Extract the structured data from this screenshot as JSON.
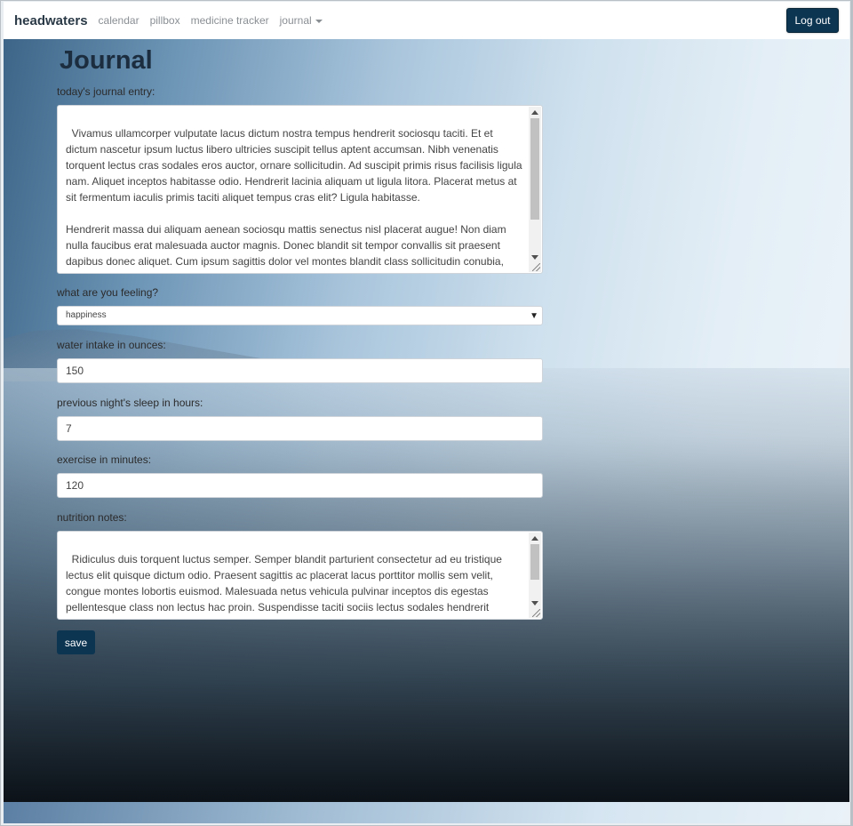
{
  "nav": {
    "brand": "headwaters",
    "links": [
      "calendar",
      "pillbox",
      "medicine tracker"
    ],
    "dropdown": "journal",
    "logout": "Log out"
  },
  "page": {
    "title": "Journal"
  },
  "form": {
    "entry_label": "today's journal entry:",
    "entry_value": "Vivamus ullamcorper vulputate lacus dictum nostra tempus hendrerit sociosqu taciti. Et et dictum nascetur ipsum luctus libero ultricies suscipit tellus aptent accumsan. Nibh venenatis torquent lectus cras sodales eros auctor, ornare sollicitudin. Ad suscipit primis risus facilisis ligula nam. Aliquet inceptos habitasse odio. Hendrerit lacinia aliquam ut ligula litora. Placerat metus at sit fermentum iaculis primis taciti aliquet tempus cras elit? Ligula habitasse.\n\nHendrerit massa dui aliquam aenean sociosqu mattis senectus nisl placerat augue! Non diam nulla faucibus erat malesuada auctor magnis. Donec blandit sit tempor convallis sit praesent dapibus donec aliquet. Cum ipsum sagittis dolor vel montes blandit class sollicitudin conubia, mauris erat. Quis curabitur fringilla leo aptent, fusce posuere in aenean quis etiam. Fermentum",
    "feeling_label": "what are you feeling?",
    "feeling_value": "happiness",
    "water_label": "water intake in ounces:",
    "water_value": "150",
    "sleep_label": "previous night's sleep in hours:",
    "sleep_value": "7",
    "exercise_label": "exercise in minutes:",
    "exercise_value": "120",
    "nutrition_label": "nutrition notes:",
    "nutrition_value": "Ridiculus duis torquent luctus semper. Semper blandit parturient consectetur ad eu tristique lectus elit quisque dictum odio. Praesent sagittis ac placerat lacus porttitor mollis sem velit, congue montes lobortis euismod. Malesuada netus vehicula pulvinar inceptos dis egestas pellentesque class non lectus hac proin. Suspendisse taciti sociis lectus sodales hendrerit facilisis phasellus ullamcorper tristique dignissim. Elementum convallis elit ullamcorper nullam",
    "save_label": "save"
  }
}
